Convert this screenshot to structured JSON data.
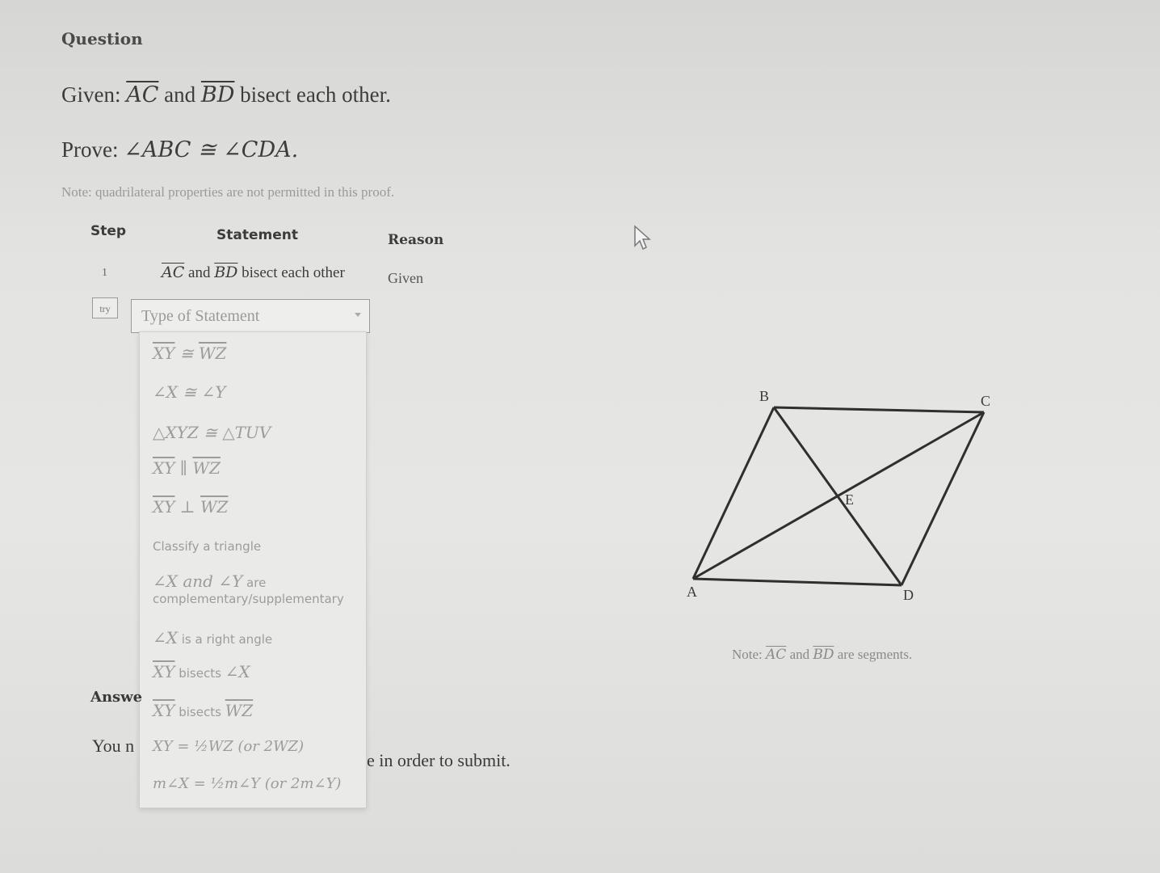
{
  "question": {
    "heading": "Question",
    "given": {
      "prefix": "Given: ",
      "seg1": "AC",
      "mid": " and ",
      "seg2": "BD",
      "suffix": " bisect each other."
    },
    "prove": {
      "prefix": "Prove: ",
      "math": "∠ABC ≅ ∠CDA."
    },
    "note": "Note: quadrilateral properties are not permitted in this proof."
  },
  "table": {
    "headers": {
      "step": "Step",
      "statement": "Statement",
      "reason": "Reason"
    },
    "row1": {
      "step": "1",
      "seg1": "AC",
      "mid": " and ",
      "seg2": "BD",
      "suffix": " bisect each other",
      "reason": "Given"
    }
  },
  "input_row": {
    "try_label": "try",
    "select_placeholder": "Type of Statement"
  },
  "dropdown": {
    "opt1": {
      "a": "XY",
      "op": " ≅ ",
      "b": "WZ"
    },
    "opt2": "∠X ≅ ∠Y",
    "opt3": "△XYZ ≅ △TUV",
    "opt4": {
      "a": "XY",
      "op": " ∥ ",
      "b": "WZ"
    },
    "opt5": {
      "a": "XY",
      "op": " ⊥ ",
      "b": "WZ"
    },
    "opt6": "Classify a triangle",
    "opt7": {
      "line1_math": "∠X and ∠Y",
      "line1_text": " are",
      "line2": "complementary/supplementary"
    },
    "opt8": {
      "math": "∠X",
      "text": " is a right angle"
    },
    "opt9": {
      "a": "XY",
      "text": " bisects ",
      "b": "∠X"
    },
    "opt10": {
      "a": "XY",
      "text": " bisects ",
      "b": "WZ"
    },
    "opt11": {
      "a": "XY = ",
      "frac": "½",
      "b": "WZ (or 2WZ)"
    },
    "opt12": {
      "a": "m∠X = ",
      "frac": "½",
      "b": "m∠Y (or 2m∠Y)"
    }
  },
  "answer": {
    "label": "Answe",
    "submit_left": "You n",
    "submit_right": "e in order to submit."
  },
  "figure": {
    "points": {
      "A": "A",
      "B": "B",
      "C": "C",
      "D": "D",
      "E": "E"
    },
    "note": {
      "prefix": "Note: ",
      "seg1": "AC",
      "mid": " and ",
      "seg2": "BD",
      "suffix": " are segments."
    }
  }
}
